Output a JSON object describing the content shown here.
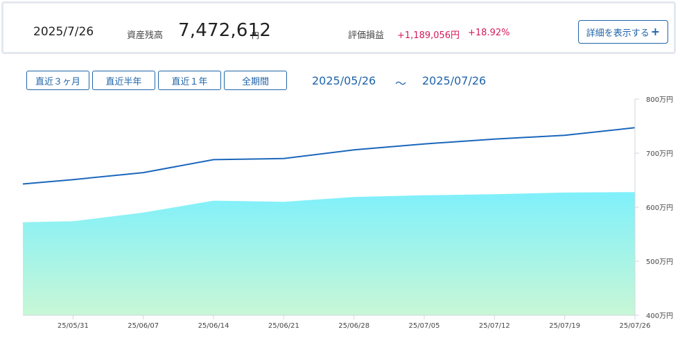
{
  "summary": {
    "date": "2025/7/26",
    "asset_label": "資産残高",
    "asset_value": "7,472,612",
    "asset_unit": "円",
    "pl_label": "評価損益",
    "pl_amount": "+1,189,056円",
    "pl_percent": "+18.92%",
    "detail_button": "詳細を表示する",
    "detail_icon": "plus-icon"
  },
  "range_buttons": [
    "直近３ヶ月",
    "直近半年",
    "直近１年",
    "全期間"
  ],
  "period": {
    "from": "2025/05/26",
    "separator": "～",
    "to": "2025/07/26"
  },
  "colors": {
    "accent": "#1f63a8",
    "gain": "#d6195a",
    "line": "#1a66bb",
    "area_top": "#7ff0fb",
    "area_bottom": "#c8f7d6"
  },
  "chart_data": {
    "type": "area",
    "x": [
      "2025/05/26",
      "2025/05/31",
      "2025/06/07",
      "2025/06/14",
      "2025/06/21",
      "2025/06/28",
      "2025/07/05",
      "2025/07/12",
      "2025/07/19",
      "2025/07/26"
    ],
    "xtick_labels": [
      "25/05/31",
      "25/06/07",
      "25/06/14",
      "25/06/21",
      "25/06/28",
      "25/07/05",
      "25/07/12",
      "25/07/19",
      "25/07/26"
    ],
    "ytick_labels": [
      "800万円",
      "700万円",
      "600万円",
      "500万円",
      "400万円"
    ],
    "ylim": [
      4000000,
      8000000
    ],
    "series": [
      {
        "kind": "line",
        "values": [
          6430000,
          6510000,
          6640000,
          6880000,
          6900000,
          7060000,
          7170000,
          7260000,
          7330000,
          7470000
        ]
      },
      {
        "kind": "area",
        "values": [
          5720000,
          5740000,
          5900000,
          6120000,
          6100000,
          6190000,
          6220000,
          6240000,
          6270000,
          6280000
        ]
      }
    ],
    "grid": false,
    "legend": "none"
  }
}
